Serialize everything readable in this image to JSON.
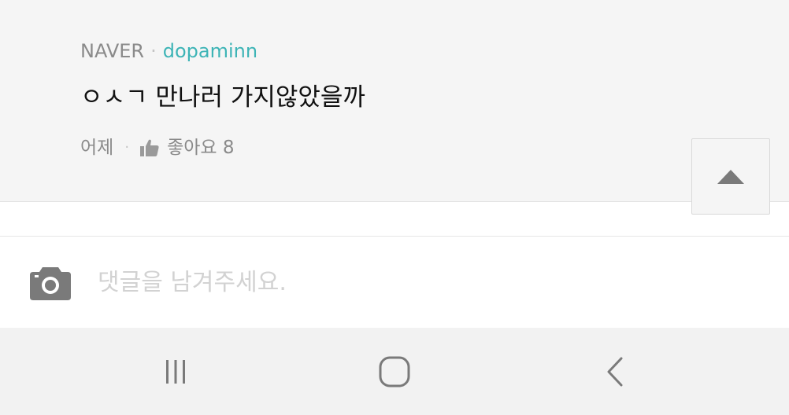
{
  "comment": {
    "source": "NAVER",
    "separator": "·",
    "username": "dopaminn",
    "text": "ㅇㅅㄱ 만나러 가지않았을까",
    "time": "어제",
    "like_label": "좋아요",
    "like_count": "8"
  },
  "top_button": {
    "icon": "triangle-up-icon"
  },
  "comment_input": {
    "placeholder": "댓글을 남겨주세요.",
    "value": "",
    "camera_icon": "camera-icon"
  },
  "nav_bar": {
    "recent_icon": "recent-apps-icon",
    "home_icon": "home-icon",
    "back_icon": "back-icon"
  },
  "colors": {
    "username": "#3db4b6",
    "comment_bg": "#f5f5f5",
    "nav_bg": "#f2f2f2",
    "icon_gray": "#7a7a7a"
  }
}
